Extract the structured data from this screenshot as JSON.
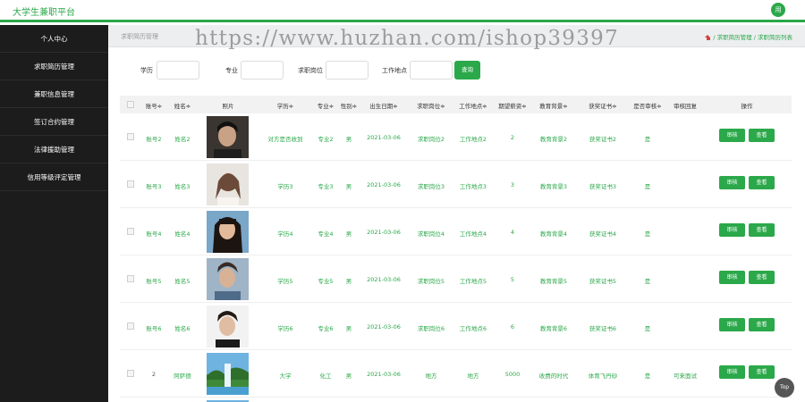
{
  "header": {
    "brand": "大学生兼职平台",
    "avatar_label": "用"
  },
  "sidebar": {
    "items": [
      {
        "label": "个人中心"
      },
      {
        "label": "求职简历管理"
      },
      {
        "label": "兼职信息管理"
      },
      {
        "label": "签订合约管理"
      },
      {
        "label": "法律援助管理"
      },
      {
        "label": "信用等级评定管理"
      }
    ]
  },
  "breadcrumb": {
    "left": "求职简历管理",
    "right": "/ 求职简历管理 / 求职简历列表"
  },
  "watermark": "https://www.huzhan.com/ishop39397",
  "search": {
    "fields": [
      {
        "label": "学历",
        "value": ""
      },
      {
        "label": "专业",
        "value": ""
      },
      {
        "label": "求职岗位",
        "value": ""
      },
      {
        "label": "工作地点",
        "value": ""
      }
    ],
    "button": "查询"
  },
  "table": {
    "headers": [
      "账号≑",
      "姓名≑",
      "照片",
      "学历≑",
      "专业≑",
      "性别≑",
      "出生日期≑",
      "求职岗位≑",
      "工作地点≑",
      "期望薪资≑",
      "教育背景≑",
      "获奖证书≑",
      "是否审核≑",
      "审核回复",
      "操作"
    ],
    "rows": [
      {
        "account": "账号2",
        "name": "姓名2",
        "edu": "对方是否收到",
        "major": "专业2",
        "gender": "男",
        "birth": "2021-03-06",
        "job": "求职岗位2",
        "place": "工作地点2",
        "salary": "2",
        "background": "教育背景2",
        "cert": "获奖证书2",
        "reviewed": "是",
        "reply": ""
      },
      {
        "account": "账号3",
        "name": "姓名3",
        "edu": "学历3",
        "major": "专业3",
        "gender": "男",
        "birth": "2021-03-06",
        "job": "求职岗位3",
        "place": "工作地点3",
        "salary": "3",
        "background": "教育背景3",
        "cert": "获奖证书3",
        "reviewed": "是",
        "reply": ""
      },
      {
        "account": "账号4",
        "name": "姓名4",
        "edu": "学历4",
        "major": "专业4",
        "gender": "男",
        "birth": "2021-03-06",
        "job": "求职岗位4",
        "place": "工作地点4",
        "salary": "4",
        "background": "教育背景4",
        "cert": "获奖证书4",
        "reviewed": "是",
        "reply": ""
      },
      {
        "account": "账号5",
        "name": "姓名5",
        "edu": "学历5",
        "major": "专业5",
        "gender": "男",
        "birth": "2021-03-06",
        "job": "求职岗位5",
        "place": "工作地点5",
        "salary": "5",
        "background": "教育背景5",
        "cert": "获奖证书5",
        "reviewed": "是",
        "reply": ""
      },
      {
        "account": "账号6",
        "name": "姓名6",
        "edu": "学历6",
        "major": "专业6",
        "gender": "男",
        "birth": "2021-03-06",
        "job": "求职岗位6",
        "place": "工作地点6",
        "salary": "6",
        "background": "教育背景6",
        "cert": "获奖证书6",
        "reviewed": "是",
        "reply": ""
      },
      {
        "account": "2",
        "name": "阿萨德",
        "edu": "大学",
        "major": "化工",
        "gender": "男",
        "birth": "2021-03-06",
        "job": "地方",
        "place": "地方",
        "salary": "5000",
        "background": "收费的时代",
        "cert": "体育飞丹砂",
        "reviewed": "是",
        "reply": "可来面试"
      }
    ],
    "actions": {
      "review": "审核",
      "view": "查看"
    }
  },
  "top_button": "Top",
  "colors": {
    "accent": "#2ba84a",
    "sidebar_bg": "#1c1c1c"
  }
}
